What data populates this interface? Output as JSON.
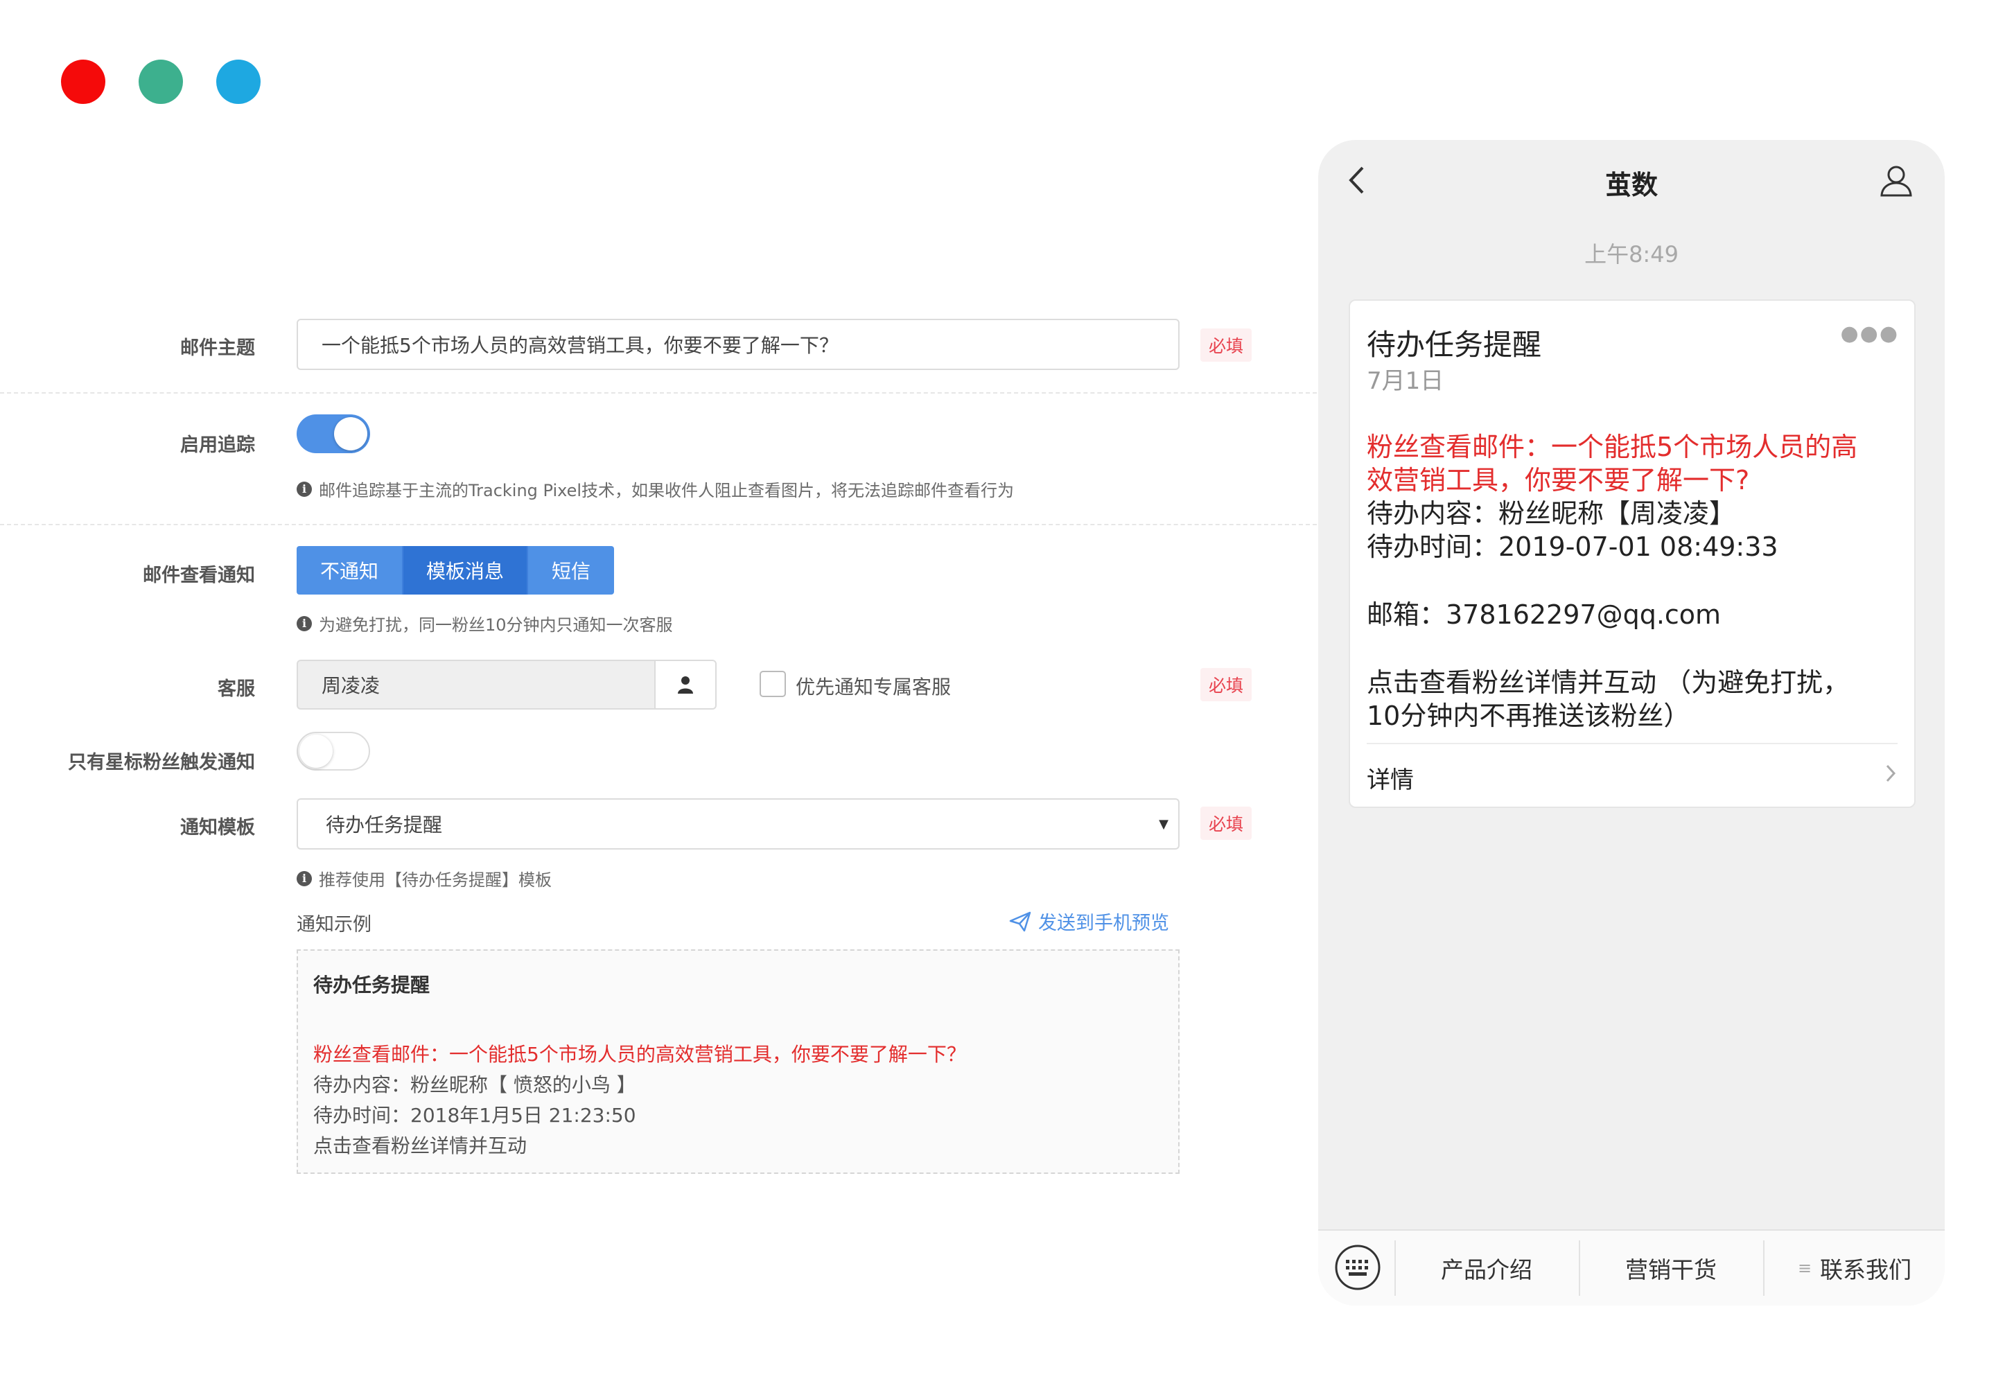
{
  "window_dots": {
    "red": "#f50a0a",
    "green": "#3db08e",
    "blue": "#1ea8e1"
  },
  "form": {
    "subject": {
      "label": "邮件主题",
      "value": "一个能抵5个市场人员的高效营销工具，你要不要了解一下？",
      "required": "必填"
    },
    "tracking": {
      "label": "启用追踪",
      "enabled": true,
      "hint": "邮件追踪基于主流的Tracking Pixel技术，如果收件人阻止查看图片，将无法追踪邮件查看行为"
    },
    "notify": {
      "label": "邮件查看通知",
      "options": [
        "不通知",
        "模板消息",
        "短信"
      ],
      "selected": "模板消息",
      "hint": "为避免打扰，同一粉丝10分钟内只通知一次客服"
    },
    "agent": {
      "label": "客服",
      "value": "周凌凌",
      "checkbox_label": "优先通知专属客服",
      "checked": false,
      "required": "必填"
    },
    "starred": {
      "label": "只有星标粉丝触发通知",
      "enabled": false
    },
    "template": {
      "label": "通知模板",
      "value": "待办任务提醒",
      "required": "必填",
      "hint": "推荐使用【待办任务提醒】模板"
    },
    "example": {
      "label": "通知示例",
      "send_link": "发送到手机预览",
      "title": "待办任务提醒",
      "line_red": "粉丝查看邮件：一个能抵5个市场人员的高效营销工具，你要不要了解一下？",
      "line1": "待办内容：粉丝昵称【 愤怒的小鸟 】",
      "line2": "待办时间：2018年1月5日 21:23:50",
      "line3": "点击查看粉丝详情并互动"
    }
  },
  "phone": {
    "title": "茧数",
    "time": "上午8:49",
    "card": {
      "title": "待办任务提醒",
      "date": "7月1日",
      "red_line1": "粉丝查看邮件：一个能抵5个市场人员的高",
      "red_line2": "效营销工具，你要不要了解一下?",
      "content": "待办内容：粉丝昵称【周凌凌】",
      "time": "待办时间：2019-07-01 08:49:33",
      "email": "邮箱：378162297@qq.com",
      "action1": "点击查看粉丝详情并互动   （为避免打扰，",
      "action2": "10分钟内不再推送该粉丝）",
      "details": "详情"
    },
    "menu": [
      "产品介绍",
      "营销干货",
      "联系我们"
    ]
  },
  "colors": {
    "accent": "#4f91e6",
    "required_bg": "#fdf0f1",
    "required_text": "#e8434f",
    "red_text": "#e32d2d"
  }
}
